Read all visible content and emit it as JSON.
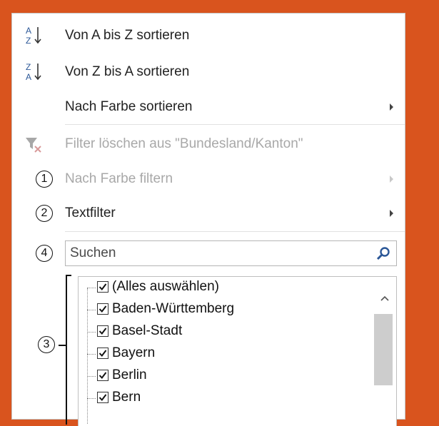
{
  "menu": {
    "sort_asc": "Von A bis Z sortieren",
    "sort_desc": "Von Z bis A sortieren",
    "sort_color": "Nach Farbe sortieren",
    "clear_filter": "Filter löschen aus \"Bundesland/Kanton\"",
    "filter_color": "Nach Farbe filtern",
    "text_filter": "Textfilter"
  },
  "callouts": [
    "1",
    "2",
    "3",
    "4"
  ],
  "search": {
    "placeholder": "Suchen"
  },
  "list": {
    "items": [
      {
        "label": "(Alles auswählen)",
        "checked": true
      },
      {
        "label": "Baden-Württemberg",
        "checked": true
      },
      {
        "label": "Basel-Stadt",
        "checked": true
      },
      {
        "label": "Bayern",
        "checked": true
      },
      {
        "label": "Berlin",
        "checked": true
      },
      {
        "label": "Bern",
        "checked": true
      }
    ]
  },
  "colors": {
    "background": "#d9541e",
    "icon_blue": "#2b5797",
    "disabled_text": "#a8a8a8"
  }
}
